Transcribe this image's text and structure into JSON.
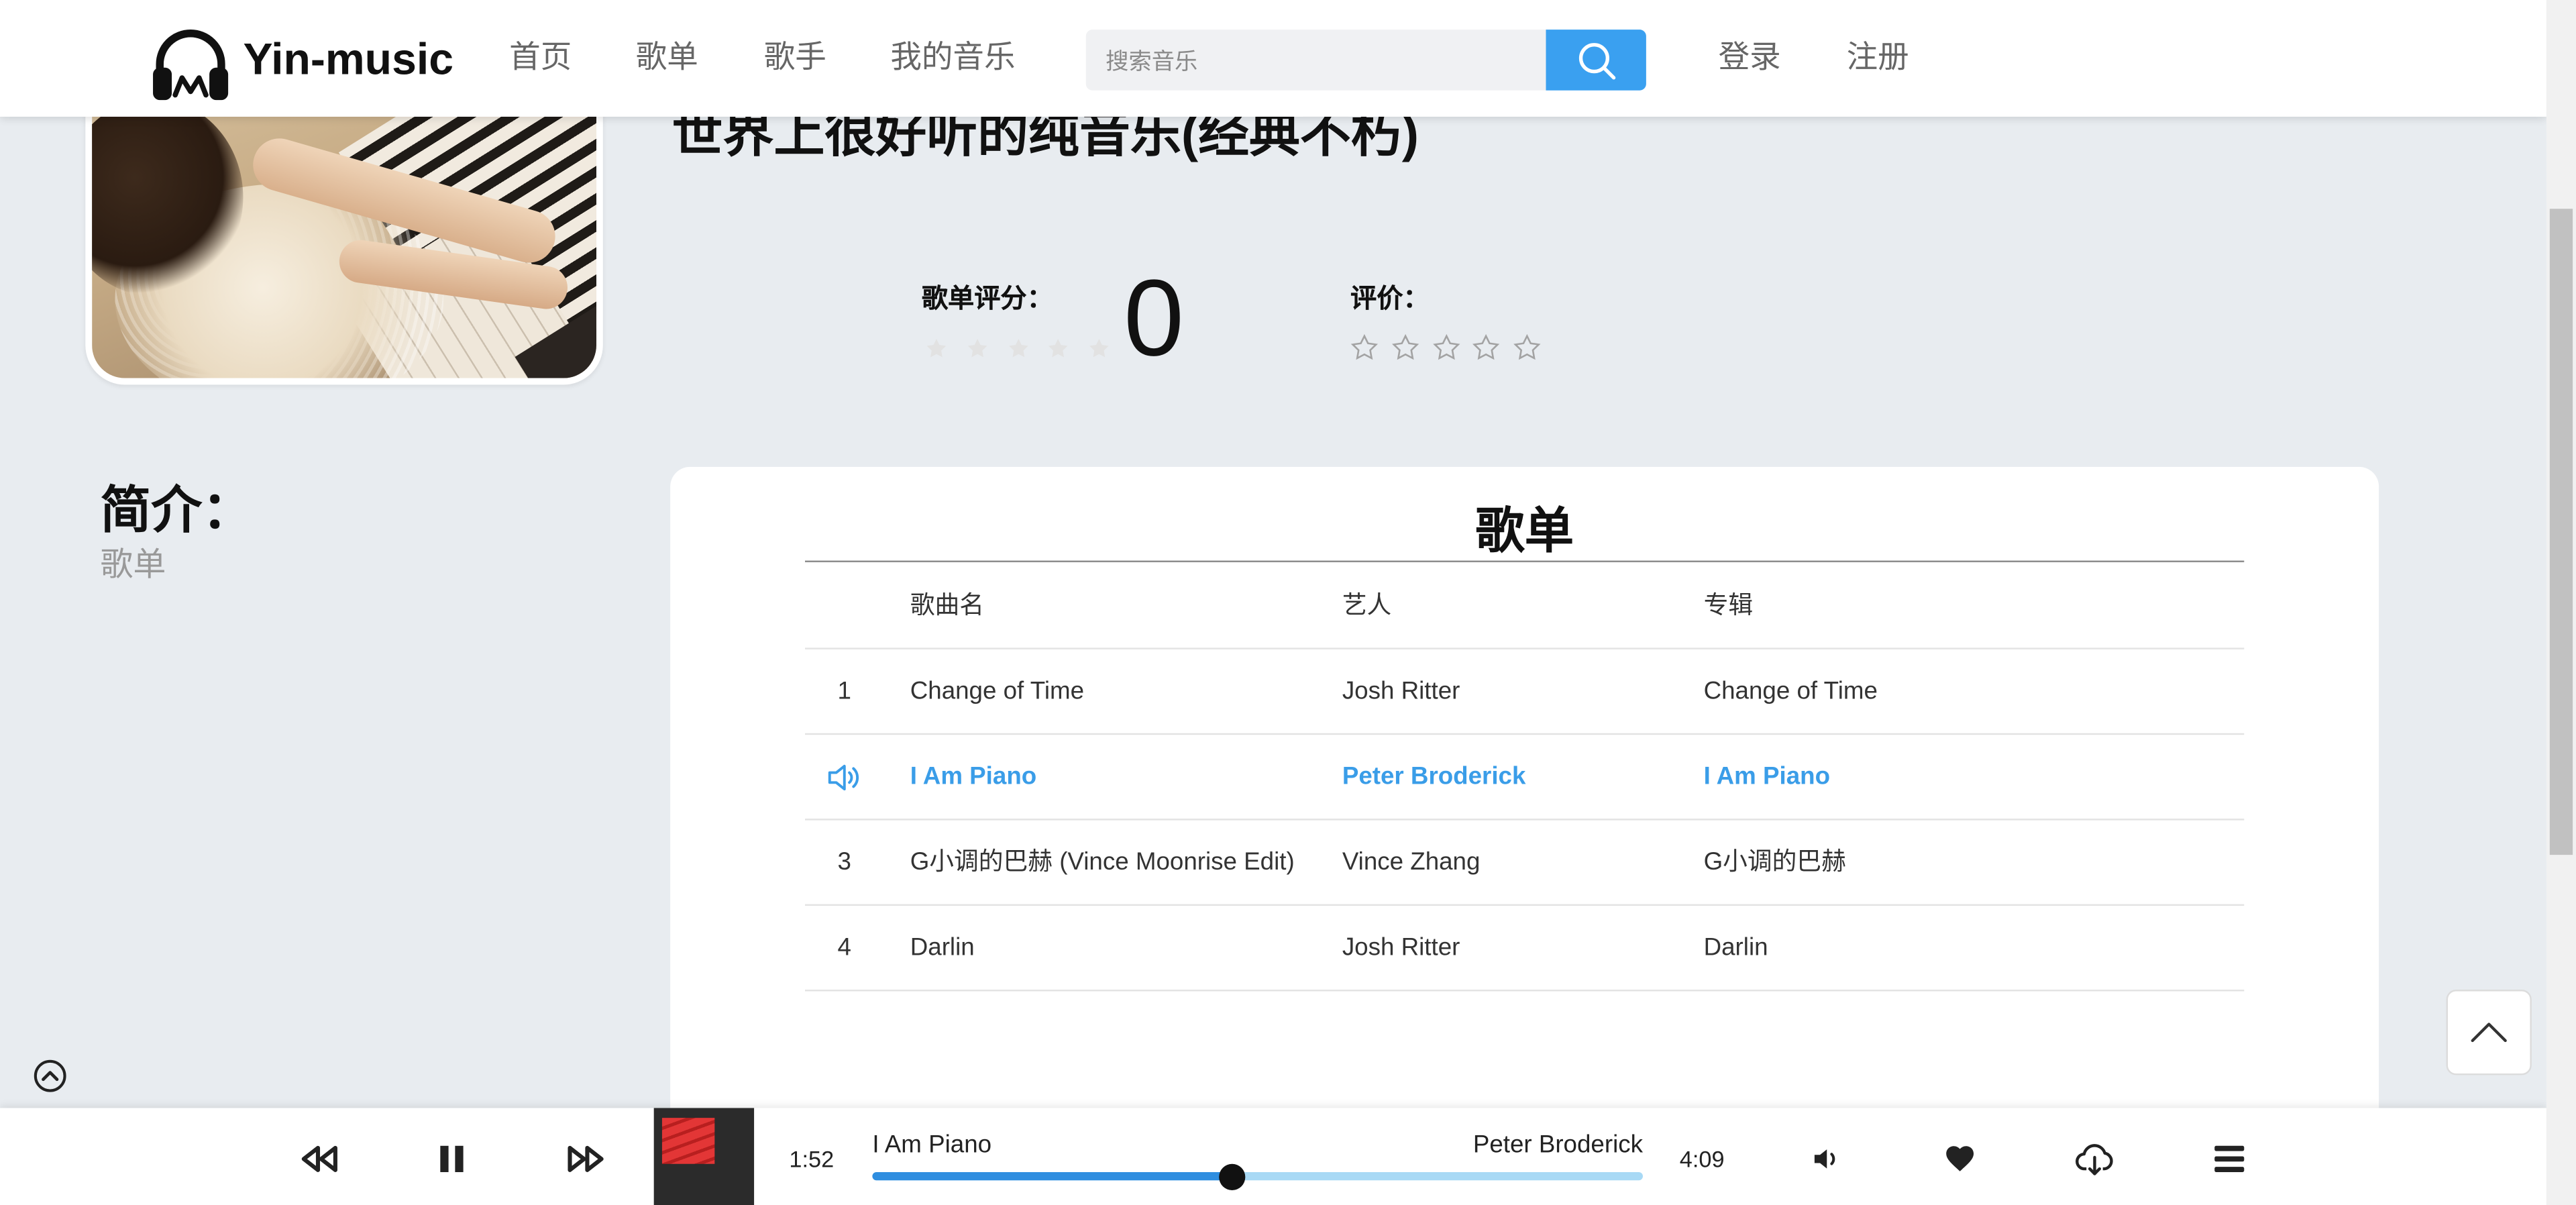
{
  "colors": {
    "accent": "#3a9de8",
    "search_button": "#3aa0f0",
    "progress_fill": "#2f8ee0",
    "progress_track": "#a8d9f5",
    "page_background": "#e8ecf0"
  },
  "header": {
    "logo_icon": "headphones-icon",
    "brand": "Yin-music",
    "nav": [
      {
        "label": "首页"
      },
      {
        "label": "歌单"
      },
      {
        "label": "歌手"
      },
      {
        "label": "我的音乐"
      }
    ],
    "search": {
      "placeholder": "搜索音乐",
      "value": "",
      "button_icon": "search-icon"
    },
    "login": "登录",
    "register": "注册"
  },
  "playlist": {
    "title": "世界上很好听的纯音乐(经典不朽)",
    "score_label": "歌单评分：",
    "score_value": "0",
    "score_stars": 0,
    "review_label": "评价：",
    "review_stars": 0,
    "stars_max": 5,
    "star_icon": "star-icon"
  },
  "intro": {
    "heading": "简介：",
    "text": "歌单"
  },
  "songlist": {
    "heading": "歌单",
    "columns": {
      "title": "歌曲名",
      "artist": "艺人",
      "album": "专辑"
    },
    "playing_icon": "speaker-icon",
    "rows": [
      {
        "index": "1",
        "title": "Change of Time",
        "artist": "Josh Ritter",
        "album": "Change of Time",
        "playing": false
      },
      {
        "title": "I Am Piano",
        "artist": "Peter Broderick",
        "album": "I Am Piano",
        "playing": true
      },
      {
        "index": "3",
        "title": "G小调的巴赫 (Vince Moonrise Edit)",
        "artist": "Vince Zhang",
        "album": "G小调的巴赫",
        "playing": false
      },
      {
        "index": "4",
        "title": "Darlin",
        "artist": "Josh Ritter",
        "album": "Darlin",
        "playing": false
      }
    ]
  },
  "side_controls": {
    "back_to_top_icon": "chevron-up-icon",
    "collapse_icon": "circle-chevron-up-icon"
  },
  "player": {
    "control_icons": [
      "rewind-icon",
      "pause-icon",
      "fast-forward-icon"
    ],
    "current_time": "1:52",
    "song": "I Am Piano",
    "artist": "Peter Broderick",
    "progress": 0.467,
    "duration": "4:09",
    "action_icons": [
      "volume-icon",
      "heart-icon",
      "cloud-download-icon",
      "menu-icon"
    ]
  }
}
